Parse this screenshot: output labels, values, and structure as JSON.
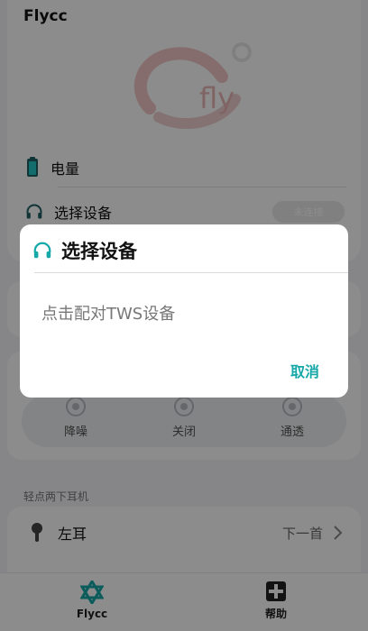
{
  "app": {
    "title": "Flycc"
  },
  "status": {
    "battery_label": "电量",
    "select_device_label": "选择设备",
    "select_device_button": "未连接"
  },
  "modes": [
    {
      "label": "降噪",
      "icon": "noise-cancel-icon"
    },
    {
      "label": "关闭",
      "icon": "off-icon"
    },
    {
      "label": "通透",
      "icon": "transparency-icon"
    }
  ],
  "gestures": {
    "section_label": "轻点两下耳机",
    "left_ear": {
      "label": "左耳",
      "value": "下一首"
    }
  },
  "bottom_nav": [
    {
      "label": "Flycc",
      "icon": "flycc-icon"
    },
    {
      "label": "帮助",
      "icon": "help-icon"
    }
  ],
  "dialog": {
    "title": "选择设备",
    "message": "点击配对TWS设备",
    "cancel_label": "取消",
    "icon": "headphones-icon"
  },
  "colors": {
    "accent": "#16a8a8",
    "battery": "#1f5f63",
    "overlay": "rgba(0,0,0,0.45)"
  }
}
